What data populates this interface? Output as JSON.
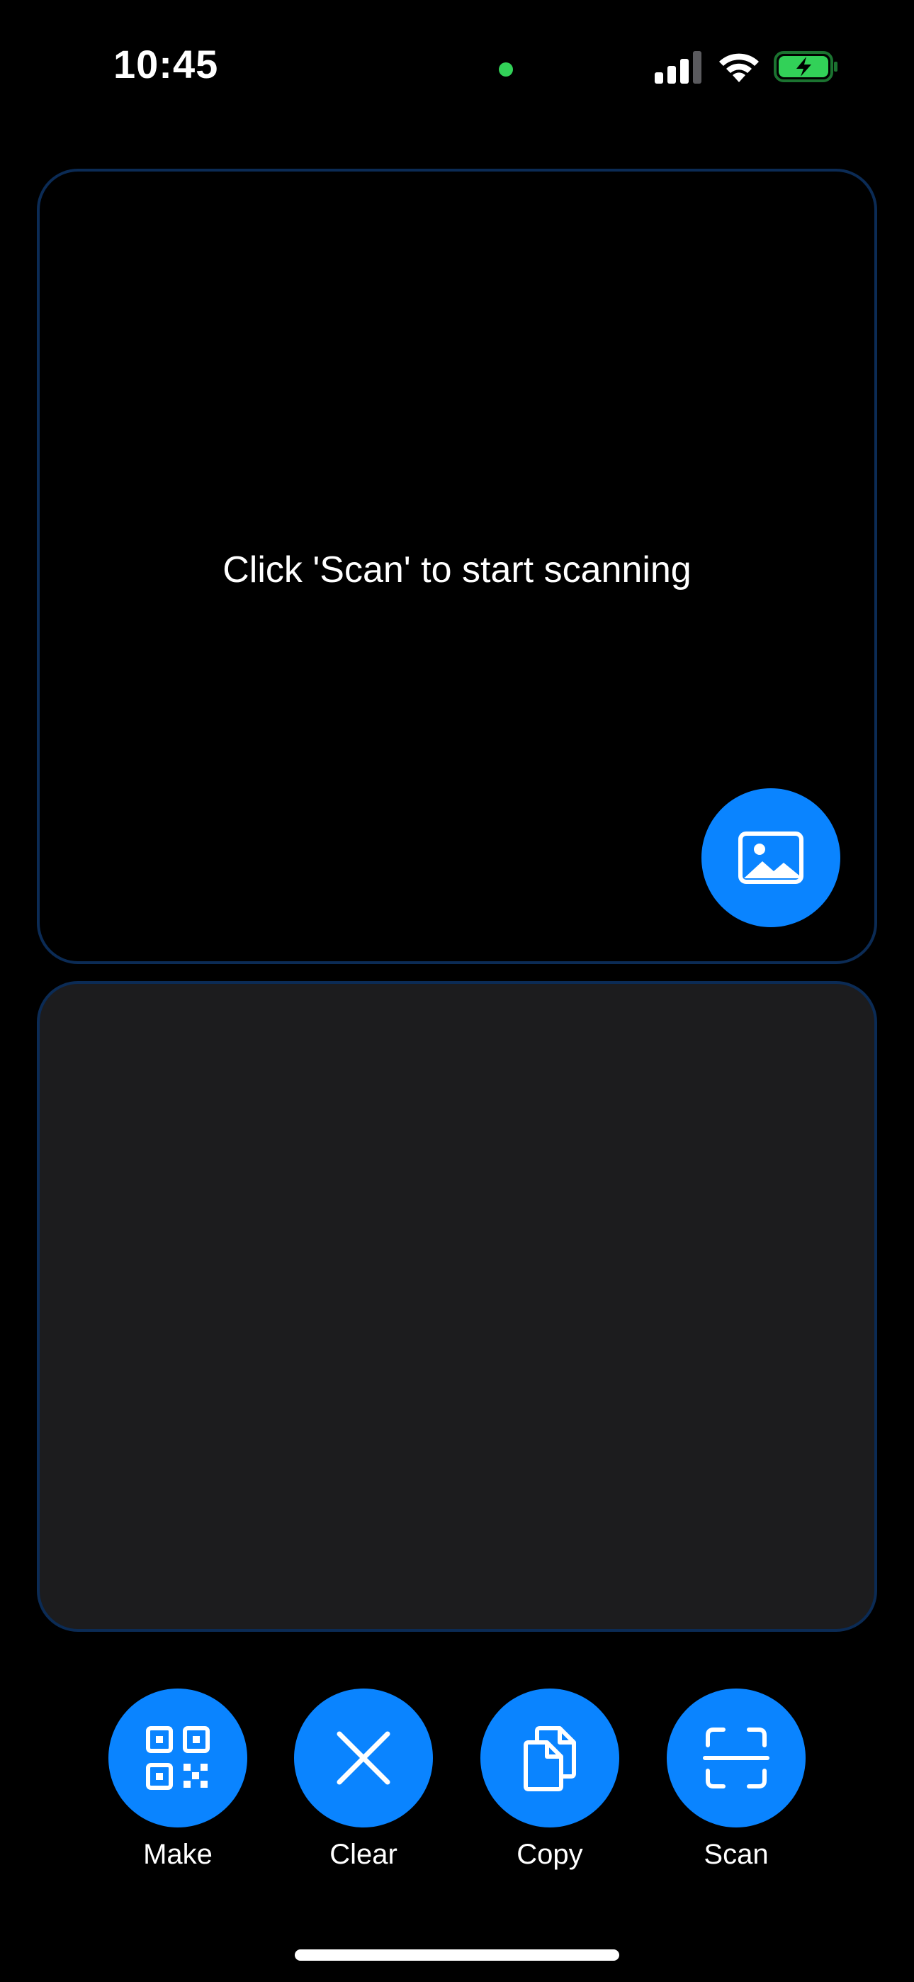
{
  "status_bar": {
    "time": "10:45",
    "signal_icon": "cellular-signal-icon",
    "wifi_icon": "wifi-icon",
    "battery_icon": "battery-charging-icon",
    "privacy_dot_color": "#32d158"
  },
  "scan_panel": {
    "prompt": "Click 'Scan' to start scanning",
    "photo_button_icon": "photo-icon"
  },
  "result_panel": {
    "text": ""
  },
  "actions": [
    {
      "label": "Make",
      "icon": "qr-code-icon"
    },
    {
      "label": "Clear",
      "icon": "close-icon"
    },
    {
      "label": "Copy",
      "icon": "copy-icon"
    },
    {
      "label": "Scan",
      "icon": "scan-frame-icon"
    }
  ],
  "colors": {
    "accent": "#0a84ff",
    "panel_border": "#0b2b55",
    "result_background": "#1c1c1e",
    "background": "#000000"
  }
}
